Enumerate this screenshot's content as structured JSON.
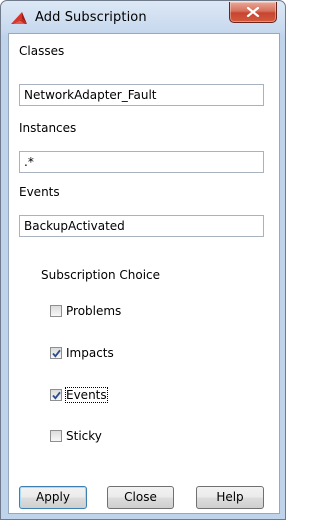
{
  "window": {
    "title": "Add Subscription",
    "app_icon": "red-triangle-logo-icon",
    "close_icon": "close-x-icon",
    "accent_color": "#c74530"
  },
  "form": {
    "classes_label": "Classes",
    "classes_value": "NetworkAdapter_Fault",
    "instances_label": "Instances",
    "instances_value": ".*",
    "events_label": "Events",
    "events_value": "BackupActivated"
  },
  "subscription_choice": {
    "title": "Subscription Choice",
    "options": [
      {
        "label": "Problems",
        "checked": false
      },
      {
        "label": "Impacts",
        "checked": true
      },
      {
        "label": "Events",
        "checked": true
      },
      {
        "label": "Sticky",
        "checked": false
      }
    ]
  },
  "buttons": {
    "apply": "Apply",
    "close": "Close",
    "help": "Help"
  }
}
